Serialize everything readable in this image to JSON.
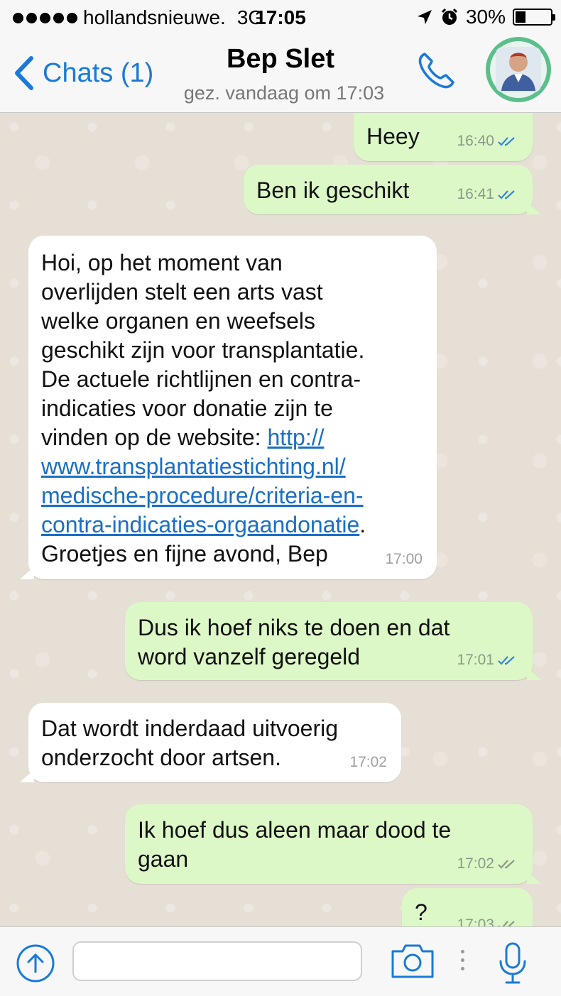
{
  "status_bar": {
    "carrier": "hollandsnieuwe.",
    "network": "3G",
    "time": "17:05",
    "battery": "30%",
    "battery_level": 0.3
  },
  "nav": {
    "back_label": "Chats (1)",
    "contact_name": "Bep Slet",
    "last_seen": "gez. vandaag om 17:03"
  },
  "messages": [
    {
      "dir": "out",
      "text": "Heey",
      "time": "16:40",
      "ticks": "read"
    },
    {
      "dir": "out",
      "text": "Ben ik geschikt",
      "time": "16:41",
      "ticks": "read"
    },
    {
      "dir": "in",
      "text_before_link": "Hoi, op het moment van\noverlijden stelt een arts vast\nwelke organen en weefsels\ngeschikt zijn voor transplantatie.\nDe actuele richtlijnen en contra-\nindicaties voor donatie zijn te\nvinden op de website: ",
      "link": "http://\nwww.transplantatiestichting.nl/\nmedische-procedure/criteria-en-\ncontra-indicaties-orgaandonatie",
      "text_after_link": ".\nGroetjes en fijne avond, Bep",
      "time": "17:00"
    },
    {
      "dir": "out",
      "text": "Dus ik hoef niks te doen en dat\nword vanzelf geregeld",
      "time": "17:01",
      "ticks": "read"
    },
    {
      "dir": "in",
      "text": "Dat wordt inderdaad uitvoerig\nonderzocht door artsen.",
      "time": "17:02"
    },
    {
      "dir": "out",
      "text": "Ik hoef dus aleen maar dood te\ngaan",
      "time": "17:02",
      "ticks": "delivered"
    },
    {
      "dir": "out",
      "text": "?",
      "time": "17:03",
      "ticks": "delivered"
    }
  ],
  "input": {
    "placeholder": "",
    "value": ""
  },
  "colors": {
    "accent": "#1a7ad9",
    "outgoing_bubble": "#dcf8c6",
    "incoming_bubble": "#ffffff",
    "read_tick": "#3b87d6",
    "delivered_tick": "#8c9a88"
  }
}
